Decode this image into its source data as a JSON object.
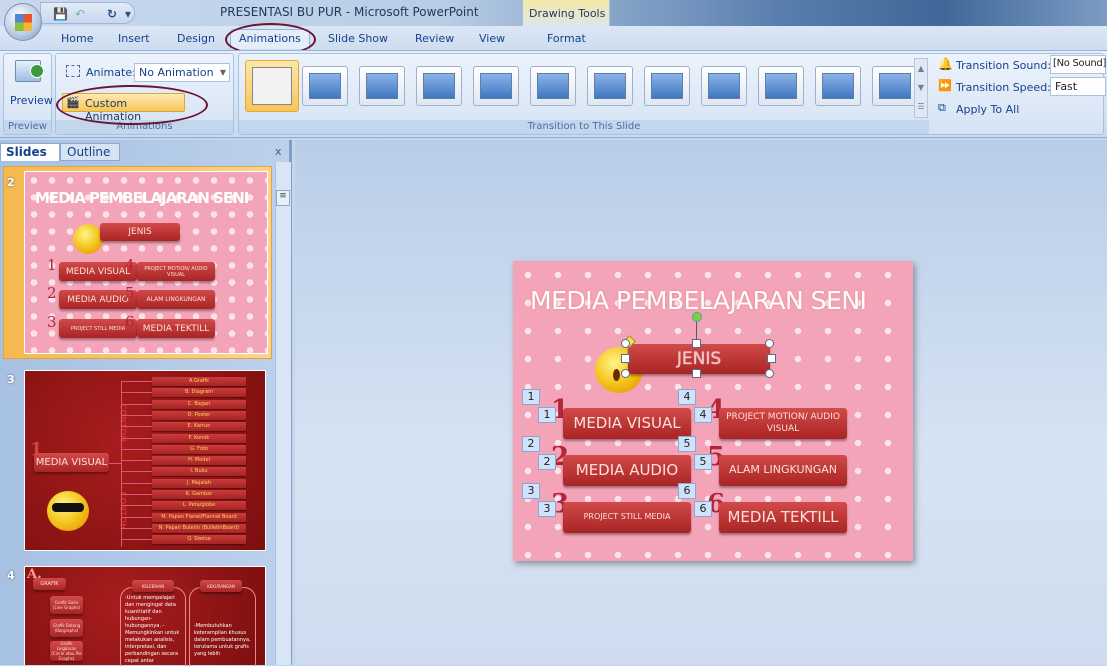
{
  "window": {
    "title": "PRESENTASI BU PUR - Microsoft PowerPoint",
    "contextual_tab_group": "Drawing Tools"
  },
  "quick_access": {
    "save": "💾",
    "undo": "↶",
    "redo": "↻",
    "more": "▾"
  },
  "tabs": [
    {
      "label": "Home"
    },
    {
      "label": "Insert"
    },
    {
      "label": "Design"
    },
    {
      "label": "Animations",
      "active": true
    },
    {
      "label": "Slide Show"
    },
    {
      "label": "Review"
    },
    {
      "label": "View"
    },
    {
      "label": "Format"
    }
  ],
  "ribbon": {
    "preview_group": {
      "button": "Preview",
      "label": "Preview"
    },
    "animations_group": {
      "animate_label": "Animate:",
      "animate_value": "No Animation",
      "custom_animation": "Custom Animation",
      "label": "Animations"
    },
    "transition_group": {
      "label": "Transition to This Slide",
      "selected_index": 0,
      "count": 12
    },
    "transition_sound_label": "Transition Sound:",
    "transition_sound_value": "[No Sound]",
    "transition_speed_label": "Transition Speed:",
    "transition_speed_value": "Fast",
    "apply_to_all": "Apply To All"
  },
  "annotation_color": "#6b1530",
  "left_pane": {
    "tabs": [
      "Slides",
      "Outline"
    ],
    "close": "x"
  },
  "slides": [
    {
      "number": "2",
      "title": "MEDIA PEMBELAJARAN SENI",
      "center_box": "JENIS",
      "items": [
        {
          "n": "1",
          "label": "MEDIA VISUAL"
        },
        {
          "n": "2",
          "label": "MEDIA AUDIO"
        },
        {
          "n": "3",
          "label": "PROJECT STILL MEDIA"
        },
        {
          "n": "4",
          "label": "PROJECT MOTION/ AUDIO VISUAL"
        },
        {
          "n": "5",
          "label": "ALAM LINGKUNGAN"
        },
        {
          "n": "6",
          "label": "MEDIA TEKTILL"
        }
      ]
    },
    {
      "number": "3",
      "main": "MEDIA VISUAL",
      "main_n": "1",
      "side_label": "CONTOH",
      "items": [
        "A.Grafik",
        "B. Diagram",
        "C. Bagan",
        "D. Poster",
        "E. Kartun",
        "F. Komik",
        "G. Foto",
        "H. Model",
        "I. Buku",
        "J. Majalah",
        "K. Gambar",
        "L. Peta/globe",
        "M. Papan Flanel/Flannel Board",
        "N. Papan Buletin (BulletinBoard)",
        "O. Sketsa"
      ]
    },
    {
      "number": "4",
      "letter": "A.",
      "main": "GRAFIK",
      "kelebihan": "KELEBIHAN",
      "kekurangan": "KEKURANGAN",
      "subitems": [
        "Grafik Garis (Line Graphs)",
        "Grafik Batang (Bargraphs)",
        "Grafik Lingkaran (Circle atau Pie Graphs)"
      ],
      "kelebihan_text": "-Untuk mempelajari dan mengingat data kuantitatif dan hubungan-hubungannya. -Memungkinkan untuk melakukan analisis, interpretasi, dan perbandingan secara cepat antar",
      "kekurangan_text": "-Membutuhkan keterampilan khusus dalam pembuatannya, terutama untuk grafis yang lebih"
    }
  ],
  "animation_tags": [
    "1",
    "2",
    "3",
    "4",
    "5",
    "6"
  ]
}
